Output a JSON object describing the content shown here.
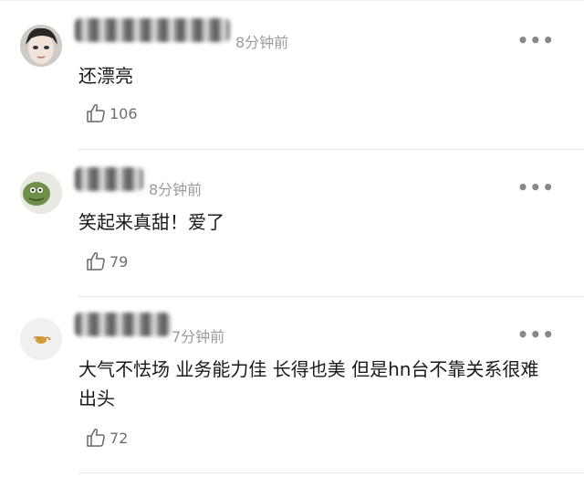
{
  "comments": [
    {
      "time": "8分钟前",
      "text": "还漂亮",
      "likes": "106"
    },
    {
      "time": "8分钟前",
      "text": "笑起来真甜！爱了",
      "likes": "79"
    },
    {
      "time": "7分钟前",
      "text": "大气不怯场 业务能力佳 长得也美 但是hn台不靠关系很难出头",
      "likes": "72"
    }
  ],
  "icons": {
    "more": "more-dots-icon",
    "like": "thumbs-up-icon"
  },
  "colors": {
    "text": "#1a1a1a",
    "meta": "#9b9b9b",
    "divider": "#e6e6e6"
  }
}
